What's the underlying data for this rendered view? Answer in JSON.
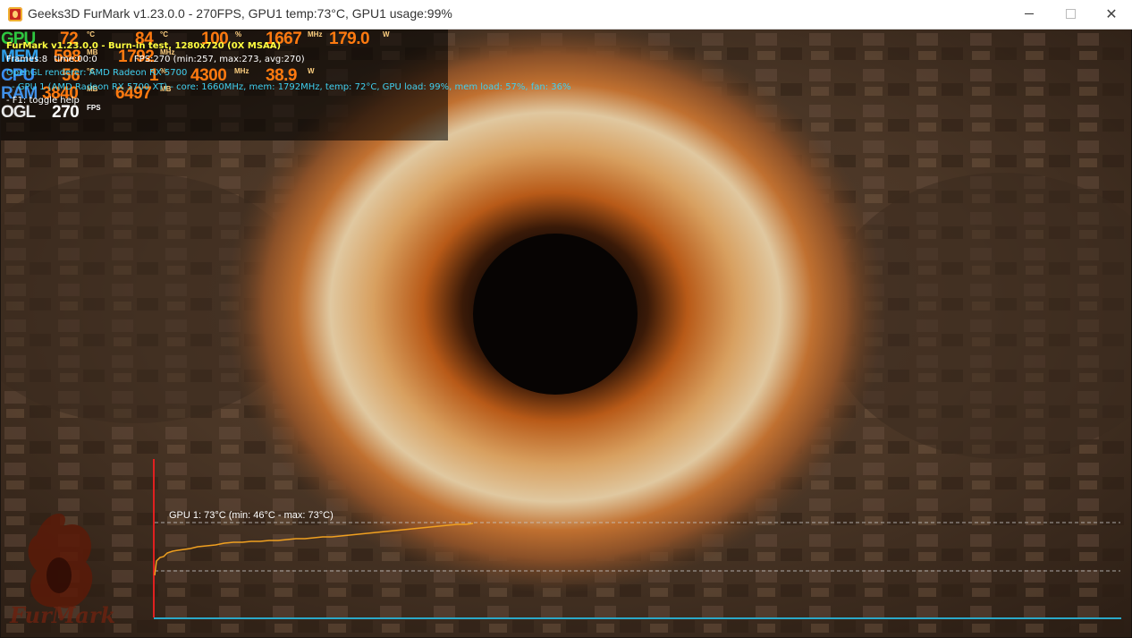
{
  "window": {
    "title": "Geeks3D FurMark v1.23.0.0 - 270FPS, GPU1 temp:73°C, GPU1 usage:99%",
    "icon": "furmark-app-icon",
    "controls": {
      "minimize": "minimize-icon",
      "maximize": "maximize-icon",
      "close": "✕"
    }
  },
  "osd": {
    "gpu": {
      "label": "GPU",
      "temp": "72",
      "temp_unit": "°C",
      "fan": "84",
      "fan_unit": "°C",
      "usage": "100",
      "usage_unit": "%",
      "clock": "1667",
      "clock_unit": "MHz",
      "power": "179.0",
      "power_unit": "W"
    },
    "mem": {
      "label": "MEM",
      "used": "598",
      "used_unit": "MB",
      "clock": "1792",
      "clock_unit": "MHz"
    },
    "cpu": {
      "label": "CPU",
      "temp": "56",
      "temp_unit": "°C",
      "usage": "1",
      "usage_unit": "%",
      "clock": "4300",
      "clock_unit": "MHz",
      "power": "38.9",
      "power_unit": "W"
    },
    "ram": {
      "label": "RAM",
      "used": "3840",
      "used_unit": "MB",
      "free": "6497",
      "free_unit": "MB"
    },
    "ogl": {
      "label": "OGL",
      "fps": "270",
      "fps_unit": "FPS"
    }
  },
  "info": {
    "line1": "FurMark v1.23.0.0 - Burn-in test, 1280x720 (0X MSAA)",
    "line2_a": "Frames:8",
    "line2_b": "time:00:0",
    "line2_c": "FPS:270 (min:257, max:273, avg:270)",
    "line3": "OpenGL renderer: AMD Radeon RX 5700",
    "line4": "- GPU 1 (AMD Radeon RX 5700 XT) - core: 1660MHz, mem: 1792MHz, temp: 72°C, GPU load: 99%, mem load: 57%, fan: 36%",
    "line5": "- F1: toggle help"
  },
  "graph": {
    "label": "GPU 1: 73°C (min: 46°C - max: 73°C)",
    "line_color": "#f0a020",
    "axis_color": "#2aa8c8",
    "marker_color": "#e02020"
  },
  "logo": {
    "text": "FurMark"
  }
}
